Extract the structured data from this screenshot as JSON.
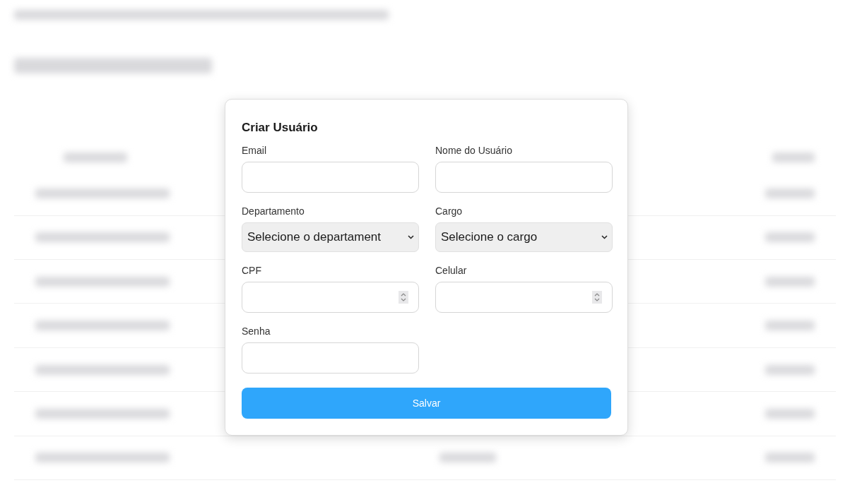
{
  "modal": {
    "title": "Criar Usuário",
    "fields": [
      {
        "kind": "text",
        "label": "Email"
      },
      {
        "kind": "text",
        "label": "Nome do Usuário"
      },
      {
        "kind": "select",
        "label": "Departamento",
        "value": "Selecione o departament"
      },
      {
        "kind": "select",
        "label": "Cargo",
        "value": "Selecione o cargo"
      },
      {
        "kind": "number",
        "label": "CPF"
      },
      {
        "kind": "number",
        "label": "Celular"
      },
      {
        "kind": "text",
        "label": "Senha"
      }
    ],
    "button": "Salvar"
  }
}
